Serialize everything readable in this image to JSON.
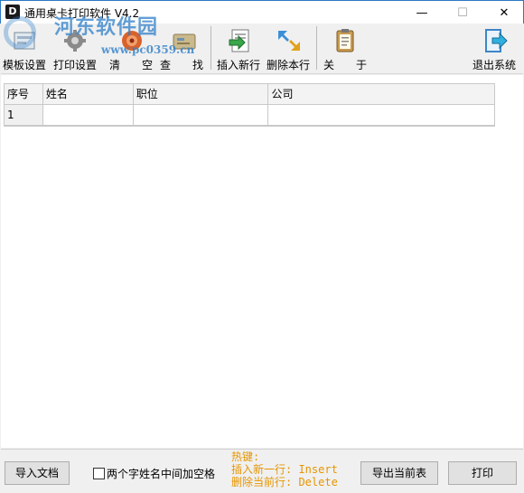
{
  "window": {
    "title": "通用桌卡打印软件    V4.2",
    "app_icon_glyph": "D",
    "minimize_glyph": "—",
    "maximize_glyph": "☐",
    "close_glyph": "✕"
  },
  "watermark": {
    "text": "河东软件园",
    "url": "www.pc0359.cn"
  },
  "toolbar": {
    "template_settings": "模板设置",
    "print_settings": "打印设置",
    "clear": "清　　空",
    "find": "查　　找",
    "insert_row": "插入新行",
    "delete_row": "删除本行",
    "about": "关　　于",
    "exit": "退出系统"
  },
  "grid": {
    "columns": [
      "序号",
      "姓名",
      "职位",
      "公司"
    ],
    "rows": [
      [
        "1",
        "",
        "",
        ""
      ]
    ]
  },
  "bottom": {
    "import_button": "导入文档",
    "checkbox_label": "两个字姓名中间加空格",
    "checkbox_checked": false,
    "hotkey_title": "热键:",
    "hotkey_insert": "插入新一行: Insert",
    "hotkey_delete": "删除当前行: Delete",
    "export_button": "导出当前表",
    "print_button": "打印"
  },
  "colors": {
    "hotkey_text": "#e69500",
    "title_border": "#2b78c2",
    "watermark": "#2f7fc9"
  }
}
